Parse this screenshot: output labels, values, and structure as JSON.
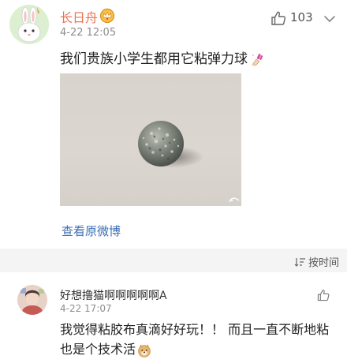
{
  "comment": {
    "author": "长日舟",
    "time": "4-22 12:05",
    "like_count": "103",
    "text": "我们贵族小学生都用它粘弹力球",
    "view_original_label": "查看原微博"
  },
  "sort": {
    "label": "按时间"
  },
  "reply": {
    "author": "好想撸猫啊啊啊啊啊A",
    "time": "4-22 17:07",
    "text": "我觉得粘胶布真滴好好玩！！ 而且一直不断地粘也是个技术活"
  },
  "colors": {
    "author_name": "#eb7350",
    "link": "#3c6eb4",
    "meta_text": "#8d8d8d",
    "separator": "#f4f4f4"
  },
  "icons": {
    "like": "thumbs-up-icon",
    "more": "chevron-down-icon",
    "vip": "crown-badge-icon",
    "sort": "sort-lines-icon"
  }
}
